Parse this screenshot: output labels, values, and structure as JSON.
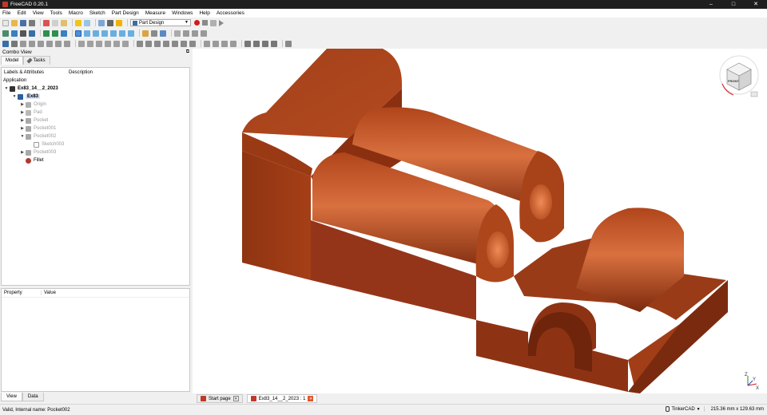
{
  "window": {
    "title": "FreeCAD 0.20.1"
  },
  "menu": [
    "File",
    "Edit",
    "View",
    "Tools",
    "Macro",
    "Sketch",
    "Part Design",
    "Measure",
    "Windows",
    "Help",
    "Accessories"
  ],
  "toolbar": {
    "workbench": "Part Design"
  },
  "combo": {
    "title": "Combo View",
    "tabs": {
      "model": "Model",
      "tasks": "Tasks"
    },
    "tree_headers": {
      "labels": "Labels & Attributes",
      "description": "Description"
    },
    "application_label": "Application",
    "tree": [
      {
        "label": "Ex83_14__2_2023",
        "level": 0,
        "expanded": true,
        "icon": "document-icon"
      },
      {
        "label": "Ex83",
        "level": 1,
        "expanded": true,
        "icon": "body-icon",
        "selected": true
      },
      {
        "label": "Origin",
        "level": 2,
        "grey": true,
        "icon": "origin-icon"
      },
      {
        "label": "Pad",
        "level": 2,
        "grey": true,
        "icon": "pad-icon"
      },
      {
        "label": "Pocket",
        "level": 2,
        "grey": true,
        "icon": "pocket-icon"
      },
      {
        "label": "Pocket001",
        "level": 2,
        "grey": true,
        "icon": "pocket-icon"
      },
      {
        "label": "Pocket002",
        "level": 2,
        "grey": true,
        "expanded": true,
        "icon": "pocket-icon"
      },
      {
        "label": "Sketch003",
        "level": 3,
        "grey": true,
        "icon": "sketch-icon"
      },
      {
        "label": "Pocket003",
        "level": 2,
        "grey": true,
        "icon": "pocket-icon"
      },
      {
        "label": "Fillet",
        "level": 2,
        "grey": false,
        "icon": "fillet-icon"
      }
    ],
    "property_headers": {
      "property": "Property",
      "value": "Value"
    },
    "bottom_tabs": {
      "view": "View",
      "data": "Data"
    }
  },
  "navcube": {
    "front_label": "FRONT"
  },
  "axis": {
    "x": "X",
    "y": "Y",
    "z": "Z"
  },
  "doc_tabs": [
    {
      "label": "Start page",
      "active": false
    },
    {
      "label": "Ex83_14__2_2023 : 1",
      "active": true
    }
  ],
  "status": {
    "message": "Valid, Internal name: Pocket002",
    "nav_style": "TinkerCAD",
    "dimensions": "215.36 mm x 129.63 mm"
  },
  "colors": {
    "model_base": "#a8421a",
    "model_light": "#d86a3d",
    "model_dark": "#6a240b",
    "selection": "#d6e2f4"
  }
}
